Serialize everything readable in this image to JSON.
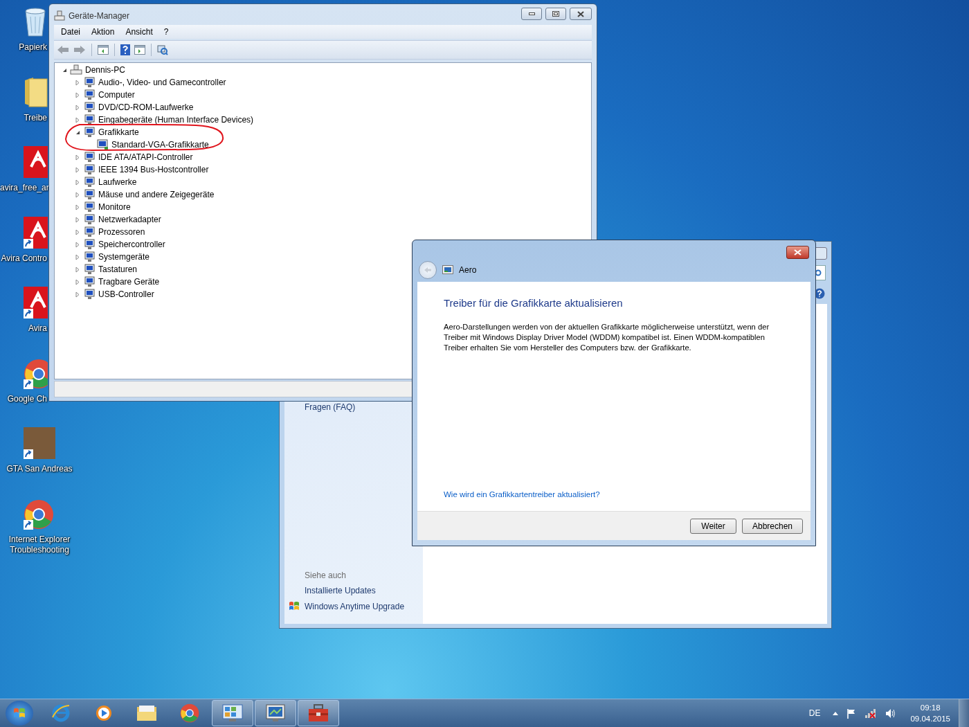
{
  "desktop_icons": [
    {
      "label": "Papierk",
      "kind": "recycle",
      "shortcut": false
    },
    {
      "label": "Treibe",
      "kind": "folder",
      "shortcut": false
    },
    {
      "label": "avira_free_ar",
      "kind": "avira",
      "shortcut": false
    },
    {
      "label": "Avira Contro",
      "kind": "avira",
      "shortcut": true
    },
    {
      "label": "Avira",
      "kind": "avira",
      "shortcut": true
    },
    {
      "label": "Google Ch",
      "kind": "chrome",
      "shortcut": true
    },
    {
      "label": "GTA San Andreas",
      "kind": "photo",
      "shortcut": true
    },
    {
      "label": "Internet Explorer Troubleshooting",
      "kind": "chrome",
      "shortcut": true
    }
  ],
  "background_window": {
    "faq_link": "Fragen (FAQ)",
    "see_also_heading": "Siehe auch",
    "see_also_links": [
      {
        "label": "Installierte Updates",
        "icon": false
      },
      {
        "label": "Windows Anytime Upgrade",
        "icon": true
      }
    ]
  },
  "device_manager": {
    "title": "Geräte-Manager",
    "menu": [
      "Datei",
      "Aktion",
      "Ansicht",
      "?"
    ],
    "tree": {
      "label": "Dennis-PC",
      "expanded": true,
      "children": [
        {
          "label": "Audio-, Video- und Gamecontroller",
          "expanded": false
        },
        {
          "label": "Computer",
          "expanded": false
        },
        {
          "label": "DVD/CD-ROM-Laufwerke",
          "expanded": false
        },
        {
          "label": "Eingabegeräte (Human Interface Devices)",
          "expanded": false
        },
        {
          "label": "Grafikkarte",
          "expanded": true,
          "children": [
            {
              "label": "Standard-VGA-Grafikkarte"
            }
          ]
        },
        {
          "label": "IDE ATA/ATAPI-Controller",
          "expanded": false
        },
        {
          "label": "IEEE 1394 Bus-Hostcontroller",
          "expanded": false
        },
        {
          "label": "Laufwerke",
          "expanded": false
        },
        {
          "label": "Mäuse und andere Zeigegeräte",
          "expanded": false
        },
        {
          "label": "Monitore",
          "expanded": false
        },
        {
          "label": "Netzwerkadapter",
          "expanded": false
        },
        {
          "label": "Prozessoren",
          "expanded": false
        },
        {
          "label": "Speichercontroller",
          "expanded": false
        },
        {
          "label": "Systemgeräte",
          "expanded": false
        },
        {
          "label": "Tastaturen",
          "expanded": false
        },
        {
          "label": "Tragbare Geräte",
          "expanded": false
        },
        {
          "label": "USB-Controller",
          "expanded": false
        }
      ]
    }
  },
  "dialog": {
    "title": "Aero",
    "heading": "Treiber für die Grafikkarte aktualisieren",
    "body": "Aero-Darstellungen werden von der aktuellen Grafikkarte möglicherweise unterstützt, wenn der Treiber mit Windows Display Driver Model (WDDM) kompatibel ist. Einen WDDM-kompatiblen Treiber erhalten Sie vom Hersteller des Computers bzw. der Grafikkarte.",
    "help_link": "Wie wird ein Grafikkartentreiber aktualisiert?",
    "buttons": [
      "Weiter",
      "Abbrechen"
    ]
  },
  "taskbar": {
    "apps": [
      {
        "kind": "ie",
        "open": false
      },
      {
        "kind": "media",
        "open": false
      },
      {
        "kind": "explorer",
        "open": false
      },
      {
        "kind": "chrome",
        "open": false
      },
      {
        "kind": "control",
        "open": true
      },
      {
        "kind": "devmgr",
        "open": true
      },
      {
        "kind": "toolbox",
        "open": true
      }
    ],
    "language": "DE",
    "time": "09:18",
    "date": "09.04.2015"
  }
}
